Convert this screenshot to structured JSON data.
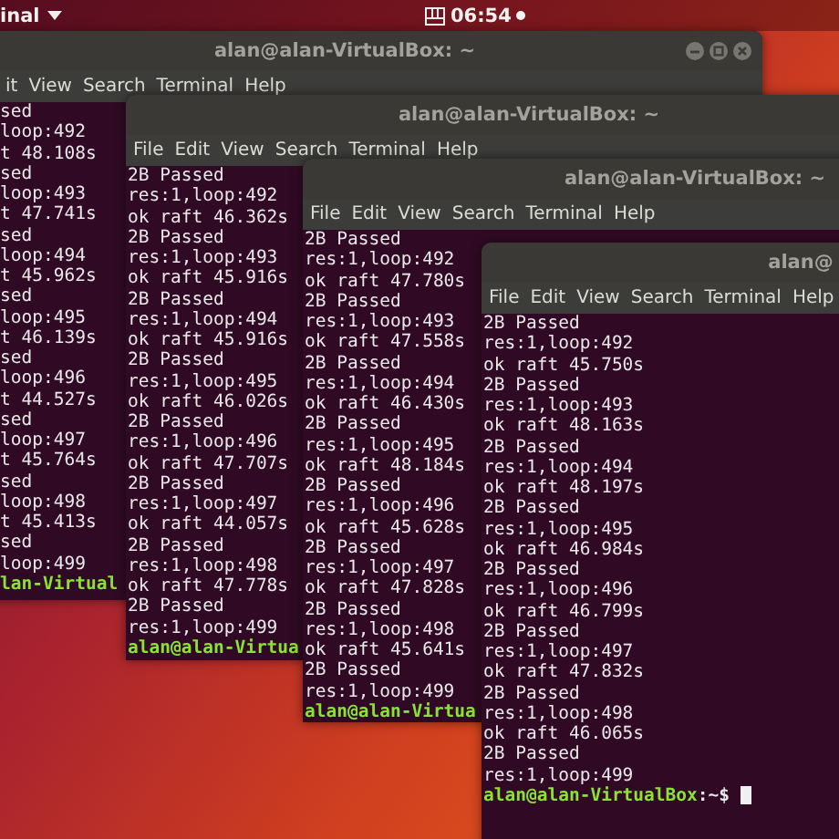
{
  "top_bar": {
    "app_menu": "inal",
    "clock": "06:54"
  },
  "windows": [
    {
      "title": "alan@alan-VirtualBox: ~",
      "menu": [
        "it",
        "View",
        "Search",
        "Terminal",
        "Help"
      ],
      "lines": [
        {
          "kind": "output",
          "text": "sed"
        },
        {
          "kind": "output",
          "text": "loop:492"
        },
        {
          "kind": "output",
          "text": "t 48.108s"
        },
        {
          "kind": "output",
          "text": "sed"
        },
        {
          "kind": "output",
          "text": "loop:493"
        },
        {
          "kind": "output",
          "text": "t 47.741s"
        },
        {
          "kind": "output",
          "text": "sed"
        },
        {
          "kind": "output",
          "text": "loop:494"
        },
        {
          "kind": "output",
          "text": "t 45.962s"
        },
        {
          "kind": "output",
          "text": "sed"
        },
        {
          "kind": "output",
          "text": "loop:495"
        },
        {
          "kind": "output",
          "text": "t 46.139s"
        },
        {
          "kind": "output",
          "text": "sed"
        },
        {
          "kind": "output",
          "text": "loop:496"
        },
        {
          "kind": "output",
          "text": "t 44.527s"
        },
        {
          "kind": "output",
          "text": "sed"
        },
        {
          "kind": "output",
          "text": "loop:497"
        },
        {
          "kind": "output",
          "text": "t 45.764s"
        },
        {
          "kind": "output",
          "text": "sed"
        },
        {
          "kind": "output",
          "text": "loop:498"
        },
        {
          "kind": "output",
          "text": "t 45.413s"
        },
        {
          "kind": "output",
          "text": "sed"
        },
        {
          "kind": "output",
          "text": "loop:499"
        },
        {
          "kind": "prompt",
          "user_host": "lan-Virtual"
        }
      ]
    },
    {
      "title": "alan@alan-VirtualBox: ~",
      "menu": [
        "File",
        "Edit",
        "View",
        "Search",
        "Terminal",
        "Help"
      ],
      "lines": [
        {
          "kind": "output",
          "text": "2B Passed"
        },
        {
          "kind": "output",
          "text": "res:1,loop:492"
        },
        {
          "kind": "output",
          "text": "ok raft 46.362s"
        },
        {
          "kind": "output",
          "text": "2B Passed"
        },
        {
          "kind": "output",
          "text": "res:1,loop:493"
        },
        {
          "kind": "output",
          "text": "ok raft 45.916s"
        },
        {
          "kind": "output",
          "text": "2B Passed"
        },
        {
          "kind": "output",
          "text": "res:1,loop:494"
        },
        {
          "kind": "output",
          "text": "ok raft 45.916s"
        },
        {
          "kind": "output",
          "text": "2B Passed"
        },
        {
          "kind": "output",
          "text": "res:1,loop:495"
        },
        {
          "kind": "output",
          "text": "ok raft 46.026s"
        },
        {
          "kind": "output",
          "text": "2B Passed"
        },
        {
          "kind": "output",
          "text": "res:1,loop:496"
        },
        {
          "kind": "output",
          "text": "ok raft 47.707s"
        },
        {
          "kind": "output",
          "text": "2B Passed"
        },
        {
          "kind": "output",
          "text": "res:1,loop:497"
        },
        {
          "kind": "output",
          "text": "ok raft 44.057s"
        },
        {
          "kind": "output",
          "text": "2B Passed"
        },
        {
          "kind": "output",
          "text": "res:1,loop:498"
        },
        {
          "kind": "output",
          "text": "ok raft 47.778s"
        },
        {
          "kind": "output",
          "text": "2B Passed"
        },
        {
          "kind": "output",
          "text": "res:1,loop:499"
        },
        {
          "kind": "prompt",
          "user_host": "alan@alan-Virtua"
        }
      ]
    },
    {
      "title": "alan@alan-VirtualBox: ~",
      "menu": [
        "File",
        "Edit",
        "View",
        "Search",
        "Terminal",
        "Help"
      ],
      "lines": [
        {
          "kind": "output",
          "text": "2B Passed"
        },
        {
          "kind": "output",
          "text": "res:1,loop:492"
        },
        {
          "kind": "output",
          "text": "ok raft 47.780s"
        },
        {
          "kind": "output",
          "text": "2B Passed"
        },
        {
          "kind": "output",
          "text": "res:1,loop:493"
        },
        {
          "kind": "output",
          "text": "ok raft 47.558s"
        },
        {
          "kind": "output",
          "text": "2B Passed"
        },
        {
          "kind": "output",
          "text": "res:1,loop:494"
        },
        {
          "kind": "output",
          "text": "ok raft 46.430s"
        },
        {
          "kind": "output",
          "text": "2B Passed"
        },
        {
          "kind": "output",
          "text": "res:1,loop:495"
        },
        {
          "kind": "output",
          "text": "ok raft 48.184s"
        },
        {
          "kind": "output",
          "text": "2B Passed"
        },
        {
          "kind": "output",
          "text": "res:1,loop:496"
        },
        {
          "kind": "output",
          "text": "ok raft 45.628s"
        },
        {
          "kind": "output",
          "text": "2B Passed"
        },
        {
          "kind": "output",
          "text": "res:1,loop:497"
        },
        {
          "kind": "output",
          "text": "ok raft 47.828s"
        },
        {
          "kind": "output",
          "text": "2B Passed"
        },
        {
          "kind": "output",
          "text": "res:1,loop:498"
        },
        {
          "kind": "output",
          "text": "ok raft 45.641s"
        },
        {
          "kind": "output",
          "text": "2B Passed"
        },
        {
          "kind": "output",
          "text": "res:1,loop:499"
        },
        {
          "kind": "prompt",
          "user_host": "alan@alan-Virtua"
        }
      ]
    },
    {
      "title": "alan@",
      "menu": [
        "File",
        "Edit",
        "View",
        "Search",
        "Terminal",
        "Help"
      ],
      "cursor": true,
      "lines": [
        {
          "kind": "output",
          "text": "2B Passed"
        },
        {
          "kind": "output",
          "text": "res:1,loop:492"
        },
        {
          "kind": "output",
          "text": "ok raft 45.750s"
        },
        {
          "kind": "output",
          "text": "2B Passed"
        },
        {
          "kind": "output",
          "text": "res:1,loop:493"
        },
        {
          "kind": "output",
          "text": "ok raft 48.163s"
        },
        {
          "kind": "output",
          "text": "2B Passed"
        },
        {
          "kind": "output",
          "text": "res:1,loop:494"
        },
        {
          "kind": "output",
          "text": "ok raft 48.197s"
        },
        {
          "kind": "output",
          "text": "2B Passed"
        },
        {
          "kind": "output",
          "text": "res:1,loop:495"
        },
        {
          "kind": "output",
          "text": "ok raft 46.984s"
        },
        {
          "kind": "output",
          "text": "2B Passed"
        },
        {
          "kind": "output",
          "text": "res:1,loop:496"
        },
        {
          "kind": "output",
          "text": "ok raft 46.799s"
        },
        {
          "kind": "output",
          "text": "2B Passed"
        },
        {
          "kind": "output",
          "text": "res:1,loop:497"
        },
        {
          "kind": "output",
          "text": "ok raft 47.832s"
        },
        {
          "kind": "output",
          "text": "2B Passed"
        },
        {
          "kind": "output",
          "text": "res:1,loop:498"
        },
        {
          "kind": "output",
          "text": "ok raft 46.065s"
        },
        {
          "kind": "output",
          "text": "2B Passed"
        },
        {
          "kind": "output",
          "text": "res:1,loop:499"
        },
        {
          "kind": "prompt",
          "user_host": "alan@alan-VirtualBox",
          "path": ":~$"
        }
      ]
    }
  ]
}
